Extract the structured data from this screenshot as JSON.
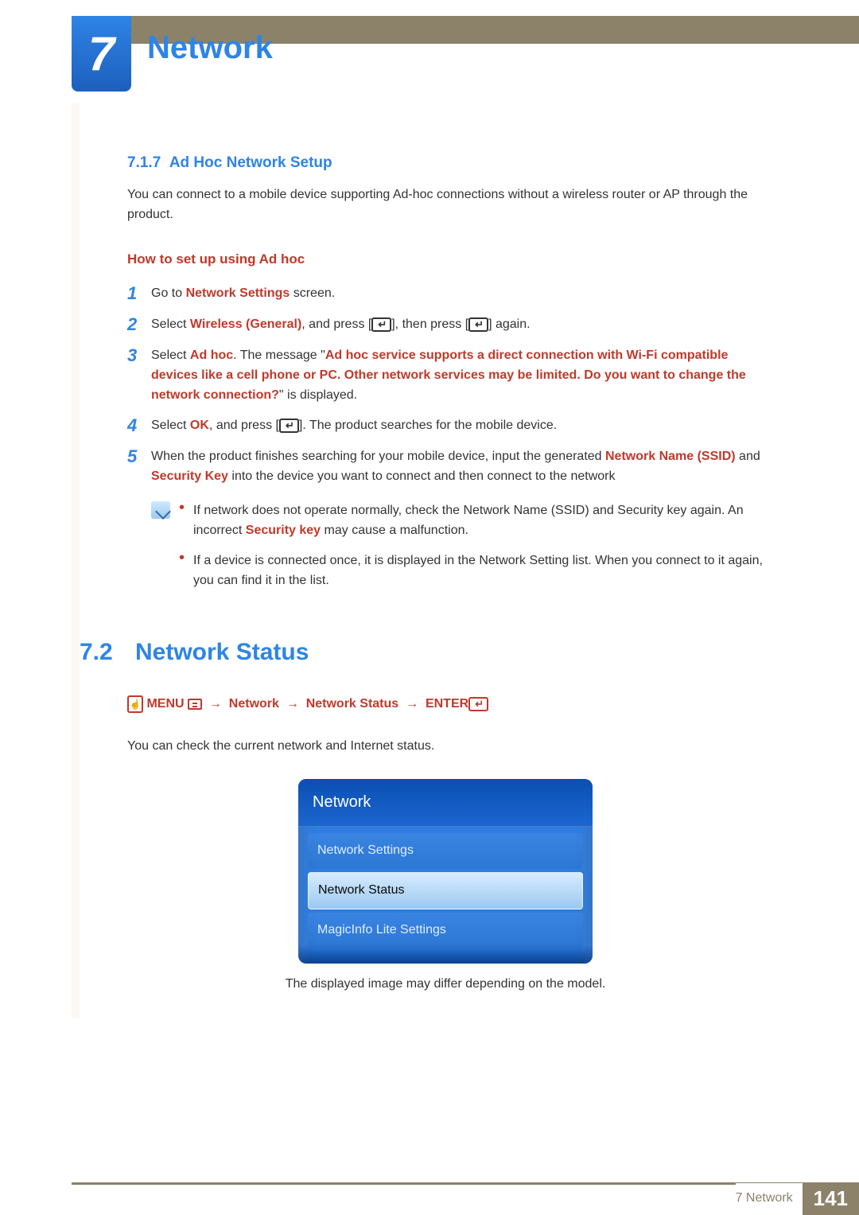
{
  "chapter": {
    "number": "7",
    "title": "Network"
  },
  "section717": {
    "number": "7.1.7",
    "title": "Ad Hoc Network Setup",
    "intro": "You can connect to a mobile device supporting Ad-hoc connections without a wireless router or AP through the product.",
    "howto_title": "How to set up using Ad hoc",
    "s1": {
      "pre": "Go to ",
      "b1": "Network Settings",
      "post": " screen."
    },
    "s2": {
      "pre": "Select ",
      "b1": "Wireless (General)",
      "mid1": ", and press [",
      "mid2": "], then press [",
      "mid3": "] again."
    },
    "s3": {
      "pre": "Select ",
      "b1": "Ad hoc",
      "mid": ". The message \"",
      "quote": "Ad hoc service supports a direct connection with Wi-Fi compatible devices like a cell phone or PC. Other network services may be limited. Do you want to change the network connection?",
      "post": "\" is displayed."
    },
    "s4": {
      "pre": "Select ",
      "b1": "OK",
      "mid1": ", and press [",
      "mid2": "]. The product searches for the mobile device."
    },
    "s5": {
      "pre": "When the product finishes searching for your mobile device, input the generated ",
      "b1": "Network Name (SSID)",
      "mid": " and ",
      "b2": "Security Key",
      "post": " into the device you want to connect and then connect to the network"
    },
    "notes": {
      "n1": {
        "pre": "If network does not operate normally, check the Network Name (SSID) and Security key again. An incorrect ",
        "b1": "Security key",
        "post": " may cause a malfunction."
      },
      "n2": "If a device is connected once, it is displayed in the Network Setting list. When you connect to it again, you can find it in the list."
    }
  },
  "section72": {
    "number": "7.2",
    "title": "Network Status",
    "path": {
      "menu": "MENU",
      "p1": "Network",
      "p2": "Network Status",
      "enter": "ENTER"
    },
    "intro": "You can check the current network and Internet status.",
    "osd": {
      "header": "Network",
      "items": [
        "Network Settings",
        "Network Status",
        "MagicInfo Lite Settings"
      ],
      "selected_index": 1
    },
    "caption": "The displayed image may differ depending on the model."
  },
  "footer": {
    "label": "7 Network",
    "page": "141"
  },
  "glyphs": {
    "enter": "↵"
  }
}
